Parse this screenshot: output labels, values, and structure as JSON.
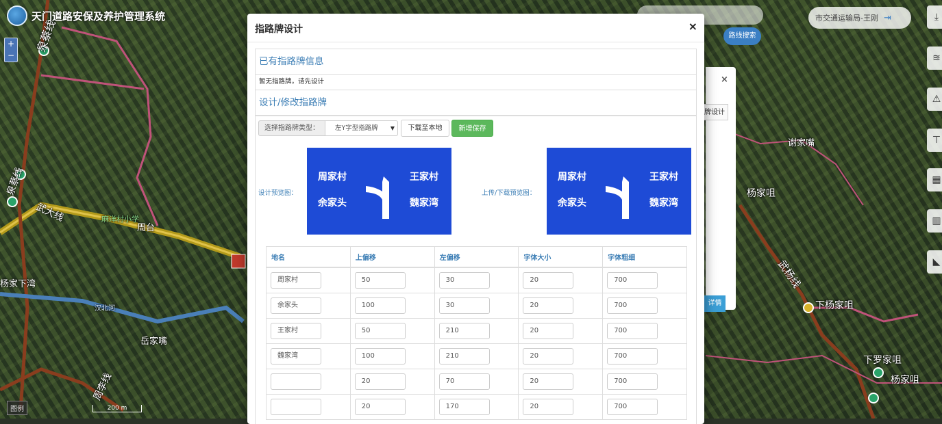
{
  "app": {
    "title": "天门道路安保及养护管理系统",
    "user": "市交通运输局-王刚",
    "route_search": "路线搜索",
    "legend_button": "图例",
    "scale_label": "200 m",
    "zoom_in": "+",
    "zoom_out": "−"
  },
  "map": {
    "labels": [
      "泉蔡线",
      "武大线",
      "泉蔡线",
      "周李线",
      "武杨线",
      "下杨家咀",
      "杨家咀",
      "下罗家咀",
      "杨家咀",
      "周台",
      "汉北河",
      "谢家嘴",
      "岳家嘴",
      "杨家下湾",
      "麻洋村小学"
    ]
  },
  "behind_panel": {
    "close": "×",
    "button_text": "牌设计",
    "blue_button": "详情"
  },
  "modal": {
    "title": "指路牌设计",
    "close": "×",
    "existing_heading": "已有指路牌信息",
    "existing_text": "暂无指路牌，请先设计",
    "design_heading": "设计/修改指路牌",
    "select_label": "选择指路牌类型：",
    "select_value": "左Y字型指路牌",
    "download_button": "下载至本地",
    "save_button": "新增保存",
    "design_preview_label": "设计预览图：",
    "upload_preview_label": "上传/下载预览图：",
    "sign": {
      "top_left": "周家村",
      "bottom_left": "余家头",
      "top_right": "王家村",
      "bottom_right": "魏家湾",
      "color": "#1e4bd6"
    },
    "table": {
      "headers": [
        "地名",
        "上偏移",
        "左偏移",
        "字体大小",
        "字体粗细"
      ],
      "rows": [
        [
          "周家村",
          "50",
          "30",
          "20",
          "700"
        ],
        [
          "余家头",
          "100",
          "30",
          "20",
          "700"
        ],
        [
          "王家村",
          "50",
          "210",
          "20",
          "700"
        ],
        [
          "魏家湾",
          "100",
          "210",
          "20",
          "700"
        ],
        [
          "",
          "20",
          "70",
          "20",
          "700"
        ],
        [
          "",
          "20",
          "170",
          "20",
          "700"
        ]
      ]
    }
  }
}
